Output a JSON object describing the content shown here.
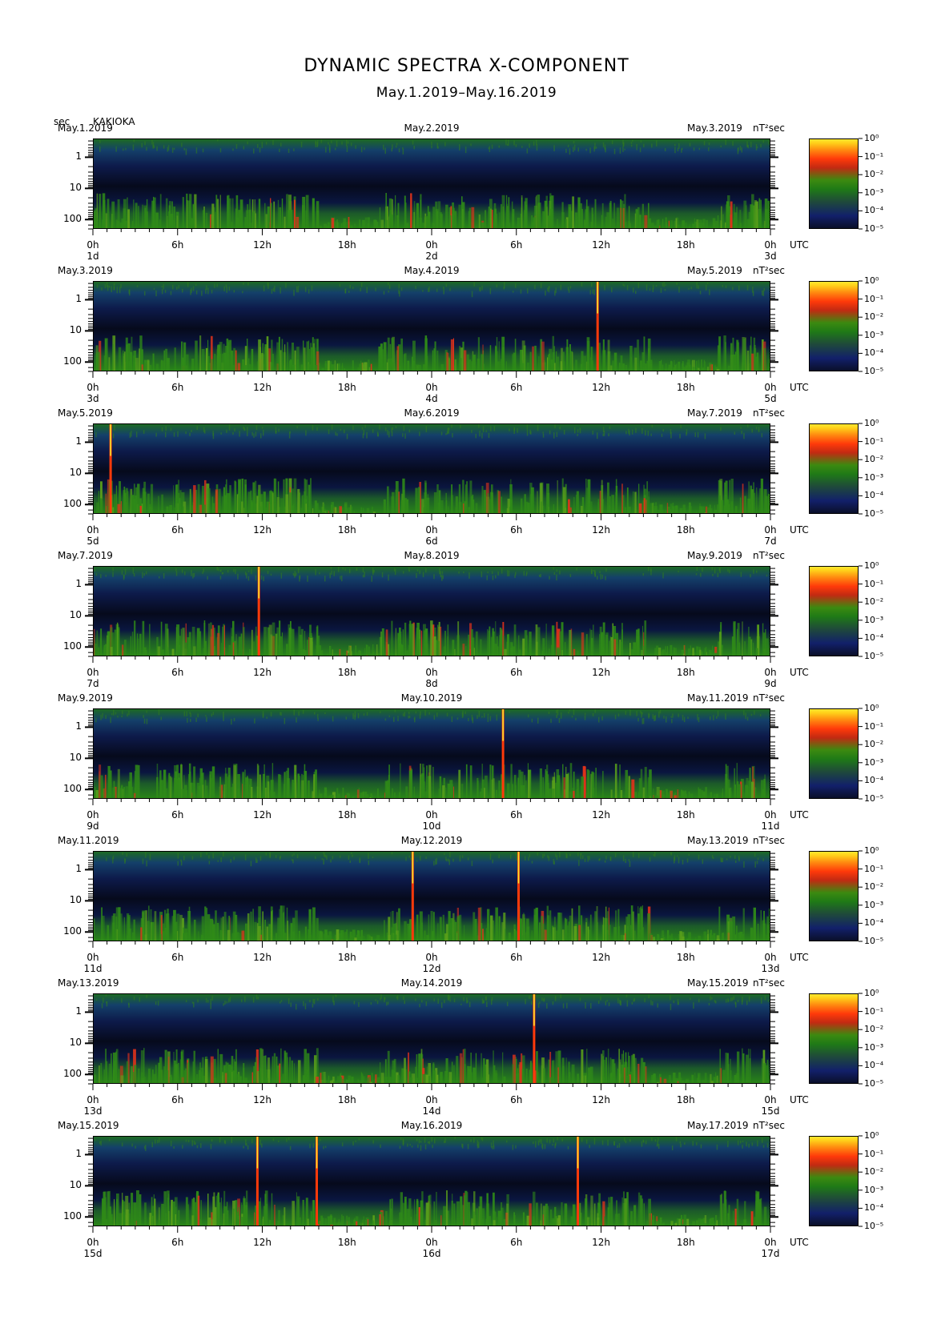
{
  "title": "DYNAMIC SPECTRA X-COMPONENT",
  "subtitle": "May.1.2019–May.16.2019",
  "unit_label": "sec",
  "station": "KAKIOKA",
  "colorbar_unit": "nT²sec",
  "x_tick_labels": [
    "0h",
    "6h",
    "12h",
    "18h",
    "0h",
    "6h",
    "12h",
    "18h",
    "0h"
  ],
  "utc_label": "UTC",
  "y_tick_labels": [
    "1",
    "10",
    "100"
  ],
  "colorbar_ticks": [
    "10⁰",
    "10⁻¹",
    "10⁻²",
    "10⁻³",
    "10⁻⁴",
    "10⁻⁵"
  ],
  "colors": {
    "low": "#0a0f2a",
    "mid_low": "#12206a",
    "mid": "#1f7a16",
    "high": "#ff3a0a",
    "max": "#ffe830"
  },
  "panels": [
    {
      "left_date": "May.1.2019",
      "mid_date": "May.2.2019",
      "right_date": "May.3.2019",
      "d_start": "1d",
      "d_mid": "2d",
      "d_end": "3d",
      "spikes": []
    },
    {
      "left_date": "May.3.2019",
      "mid_date": "May.4.2019",
      "right_date": "May.5.2019",
      "d_start": "3d",
      "d_mid": "4d",
      "d_end": "5d",
      "spikes": [
        35.7
      ]
    },
    {
      "left_date": "May.5.2019",
      "mid_date": "May.6.2019",
      "right_date": "May.7.2019",
      "d_start": "5d",
      "d_mid": "6d",
      "d_end": "7d",
      "spikes": [
        1.2
      ]
    },
    {
      "left_date": "May.7.2019",
      "mid_date": "May.8.2019",
      "right_date": "May.9.2019",
      "d_start": "7d",
      "d_mid": "8d",
      "d_end": "9d",
      "spikes": [
        11.7
      ]
    },
    {
      "left_date": "May.9.2019",
      "mid_date": "May.10.2019",
      "right_date": "May.11.2019",
      "d_start": "9d",
      "d_mid": "10d",
      "d_end": "11d",
      "spikes": [
        29.0
      ]
    },
    {
      "left_date": "May.11.2019",
      "mid_date": "May.12.2019",
      "right_date": "May.13.2019",
      "d_start": "11d",
      "d_mid": "12d",
      "d_end": "13d",
      "spikes": [
        22.6,
        30.1
      ]
    },
    {
      "left_date": "May.13.2019",
      "mid_date": "May.14.2019",
      "right_date": "May.15.2019",
      "d_start": "13d",
      "d_mid": "14d",
      "d_end": "15d",
      "spikes": [
        31.2
      ]
    },
    {
      "left_date": "May.15.2019",
      "mid_date": "May.16.2019",
      "right_date": "May.17.2019",
      "d_start": "15d",
      "d_mid": "16d",
      "d_end": "17d",
      "spikes": [
        11.6,
        15.8,
        34.3
      ]
    }
  ],
  "chart_data": {
    "type": "heatmap",
    "title": "DYNAMIC SPECTRA X-COMPONENT",
    "subtitle": "May.1.2019–May.16.2019",
    "ylabel": "sec",
    "y_scale": "log",
    "y_ticks": [
      1,
      10,
      100
    ],
    "x_ticks_hours": [
      0,
      6,
      12,
      18,
      24,
      30,
      36,
      42,
      48
    ],
    "x_range_hours": [
      0,
      48
    ],
    "color_scale": "log",
    "color_range": [
      1e-05,
      1
    ],
    "color_unit": "nT²sec",
    "panel_count": 8,
    "station": "KAKIOKA"
  }
}
